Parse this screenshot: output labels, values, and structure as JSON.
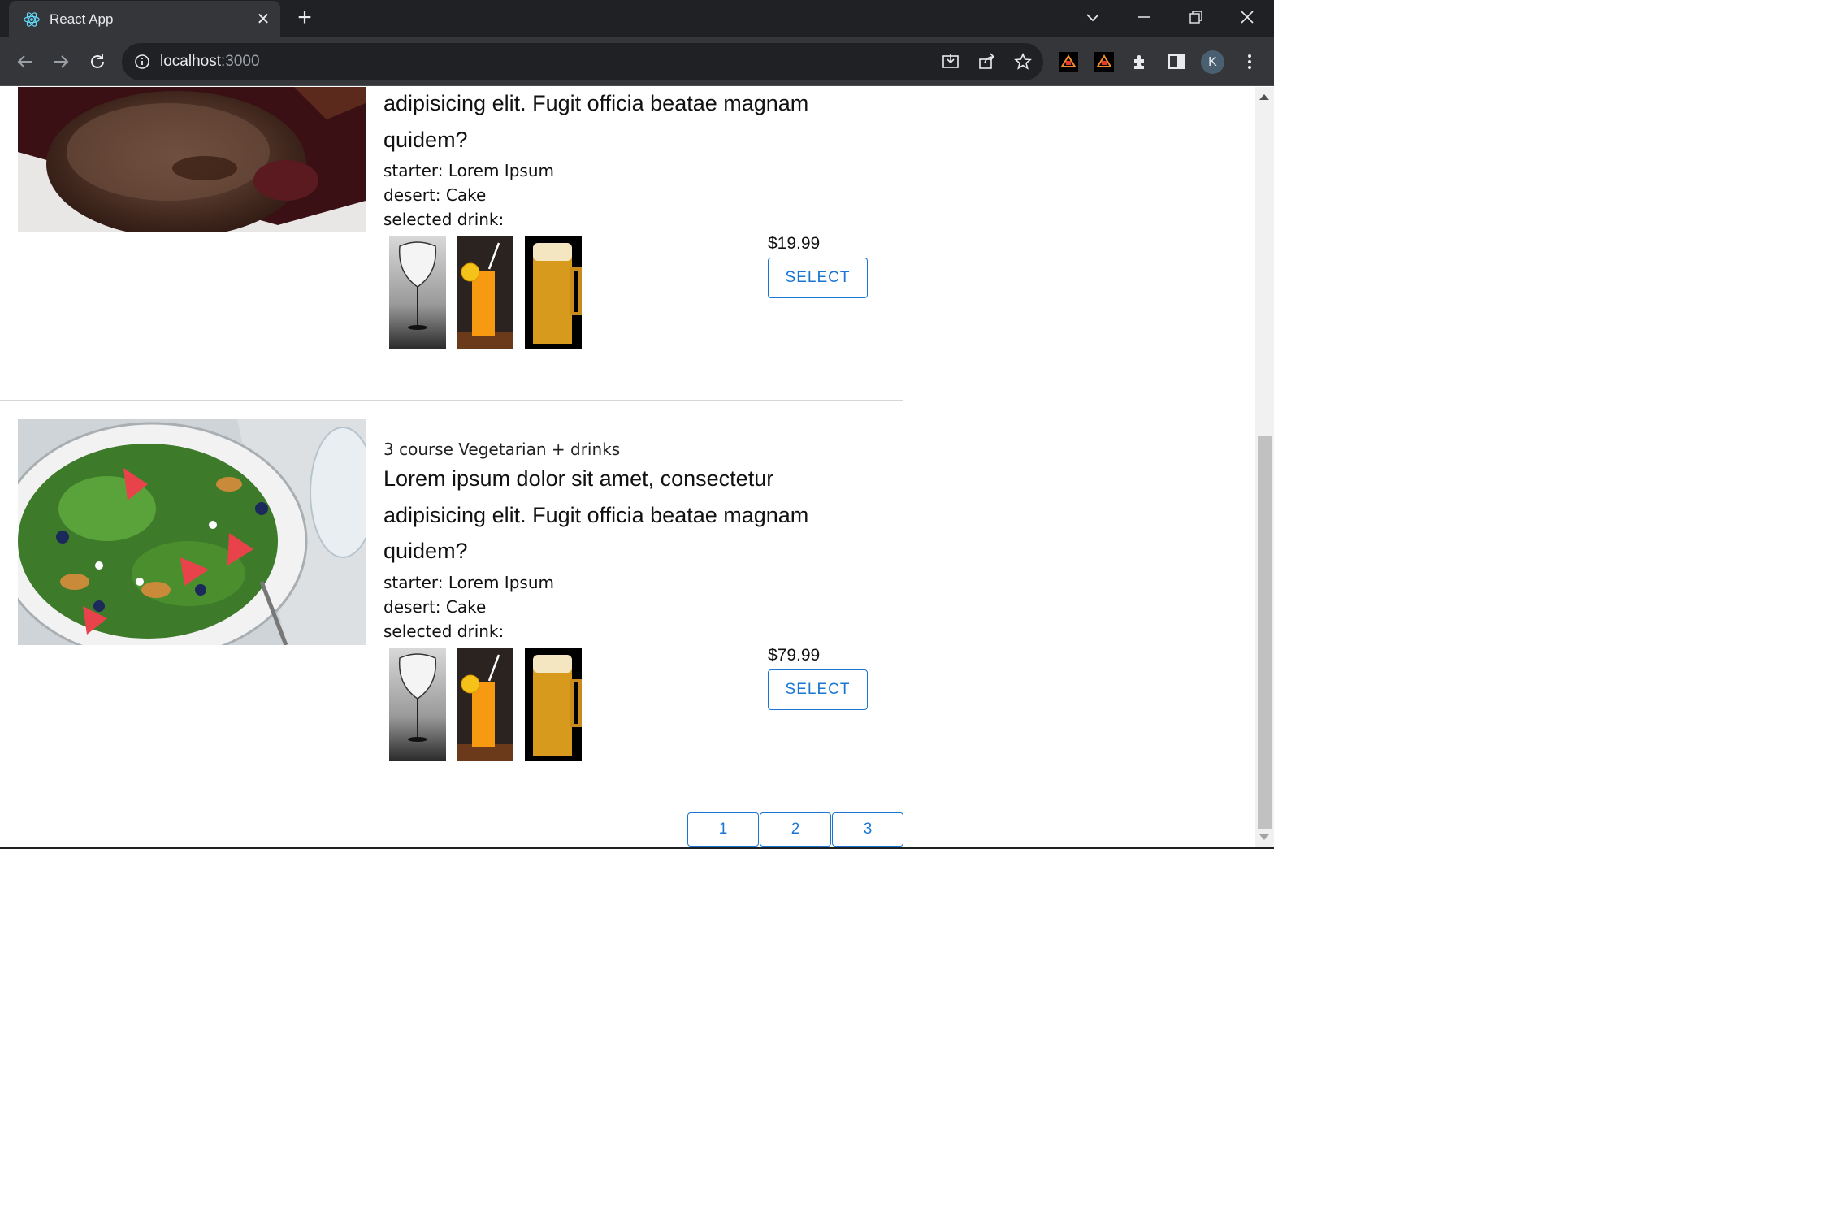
{
  "browser": {
    "tab_title": "React App",
    "url_host": "localhost",
    "url_port": ":3000",
    "profile_initial": "K"
  },
  "menu": [
    {
      "subtitle": "",
      "description": "adipisicing elit. Fugit officia beatae magnam quidem?",
      "starter": "starter: Lorem Ipsum",
      "desert": "desert: Cake",
      "drink_label": "selected drink:",
      "price": "$19.99",
      "select_label": "SELECT",
      "image": "steak-photo",
      "drinks": [
        "wine-glass",
        "orange-juice",
        "beer-mug"
      ]
    },
    {
      "subtitle": "3 course Vegetarian + drinks",
      "description": "Lorem ipsum dolor sit amet, consectetur adipisicing elit. Fugit officia beatae magnam quidem?",
      "starter": "starter: Lorem Ipsum",
      "desert": "desert: Cake",
      "drink_label": "selected drink:",
      "price": "$79.99",
      "select_label": "SELECT",
      "image": "salad-photo",
      "drinks": [
        "wine-glass",
        "orange-juice",
        "beer-mug"
      ]
    }
  ],
  "pagination": {
    "pages": [
      "1",
      "2",
      "3"
    ]
  },
  "colors": {
    "accent": "#1976d2",
    "chrome_dark": "#202124",
    "chrome_toolbar": "#35363a"
  }
}
